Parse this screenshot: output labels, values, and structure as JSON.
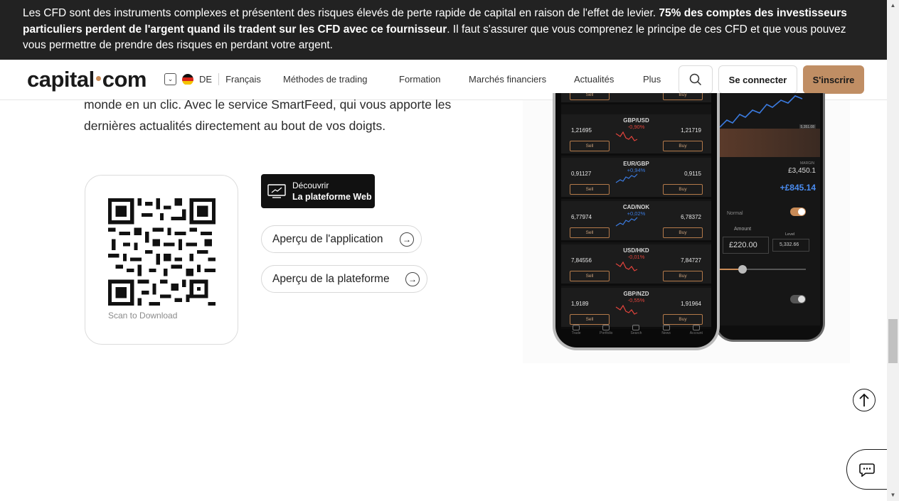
{
  "risk_banner": {
    "text_1": "Les CFD sont des instruments complexes et présentent des risques élevés de perte rapide de capital en raison de l'effet de levier. ",
    "text_bold": "75% des comptes des investisseurs particuliers perdent de l'argent quand ils tradent sur les CFD avec ce fournisseur",
    "text_2": ". Il faut s'assurer que vous comprenez le principe de ces CFD et que vous pouvez vous permettre de prendre des risques en perdant votre argent."
  },
  "header": {
    "logo_left": "capital",
    "logo_right": "com",
    "region": "DE",
    "language": "Français",
    "nav": [
      "Méthodes de trading",
      "Formation",
      "Marchés financiers",
      "Actualités",
      "Plus"
    ],
    "login": "Se connecter",
    "signup": "S'inscrire"
  },
  "content": {
    "paragraph": "monde en un clic. Avec le service SmartFeed, qui vous apporte les dernières actualités directement au bout de vos doigts.",
    "qr_caption": "Scan to Download",
    "web_button": {
      "line1": "Découvrir",
      "line2": "La plateforme Web"
    },
    "app_preview": "Aperçu de l'application",
    "platform_preview": "Aperçu de la plateforme"
  },
  "phone_front": {
    "pairs": [
      {
        "name": "",
        "bid": "",
        "change": "",
        "ask": "",
        "color": "#e0433b"
      },
      {
        "name": "GBP/USD",
        "bid": "1,21695",
        "change": "-0,90%",
        "ask": "1,21719",
        "color": "#e0433b"
      },
      {
        "name": "EUR/GBP",
        "bid": "0,91127",
        "change": "+0,94%",
        "ask": "0,9115",
        "color": "#3b7be0"
      },
      {
        "name": "CAD/NOK",
        "bid": "6,77974",
        "change": "+0,02%",
        "ask": "6,78372",
        "color": "#3b7be0"
      },
      {
        "name": "USD/HKD",
        "bid": "7,84556",
        "change": "-0,01%",
        "ask": "7,84727",
        "color": "#e0433b"
      },
      {
        "name": "GBP/NZD",
        "bid": "1,9189",
        "change": "-0,55%",
        "ask": "1,91964",
        "color": "#e0433b"
      }
    ],
    "sell_label": "Sell",
    "buy_label": "Buy",
    "tabs": [
      "Trade",
      "Portfolio",
      "Search",
      "News",
      "Account"
    ]
  },
  "phone_back": {
    "price_tag": "5,351.08",
    "margin_label": "MARGIN",
    "balance": "£3,450.1",
    "profit": "+£845.14",
    "order_type": "Normal",
    "amount_label": "Amount",
    "level_label": "Level",
    "amount_value": "£220.00",
    "level_value": "5,332.66"
  },
  "colors": {
    "accent": "#c08e64",
    "banner_bg": "#222222",
    "negative": "#e0433b",
    "positive": "#3b7be0"
  }
}
